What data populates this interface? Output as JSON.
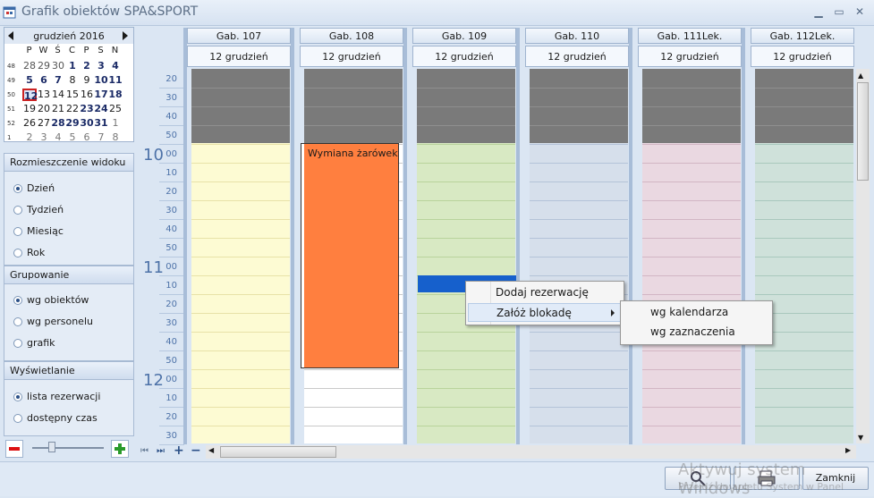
{
  "window": {
    "title": "Grafik obiektów SPA&SPORT",
    "min_label": "▁",
    "max_label": "▭",
    "close_label": "✕",
    "system_icon": "calendar-app-icon"
  },
  "calendar": {
    "month_label": "grudzień 2016",
    "weekdays": [
      "P",
      "W",
      "Ś",
      "C",
      "P",
      "S",
      "N"
    ],
    "weeks": [
      {
        "wk": "48",
        "days": [
          "28",
          "29",
          "30",
          "1",
          "2",
          "3",
          "4"
        ]
      },
      {
        "wk": "49",
        "days": [
          "5",
          "6",
          "7",
          "8",
          "9",
          "10",
          "11"
        ]
      },
      {
        "wk": "50",
        "days": [
          "12",
          "13",
          "14",
          "15",
          "16",
          "17",
          "18"
        ]
      },
      {
        "wk": "51",
        "days": [
          "19",
          "20",
          "21",
          "22",
          "23",
          "24",
          "25"
        ]
      },
      {
        "wk": "52",
        "days": [
          "26",
          "27",
          "28",
          "29",
          "30",
          "31",
          "1"
        ]
      },
      {
        "wk": "1",
        "days": [
          "2",
          "3",
          "4",
          "5",
          "6",
          "7",
          "8"
        ]
      }
    ]
  },
  "layout_panel": {
    "title": "Rozmieszczenie widoku",
    "options": [
      "Dzień",
      "Tydzień",
      "Miesiąc",
      "Rok"
    ],
    "selected": "Dzień"
  },
  "grouping_panel": {
    "title": "Grupowanie",
    "options": [
      "wg obiektów",
      "wg personelu",
      "grafik"
    ],
    "selected": "wg obiektów"
  },
  "display_panel": {
    "title": "Wyświetlanie",
    "options": [
      "lista rezerwacji",
      "dostępny czas"
    ],
    "selected": "lista rezerwacji"
  },
  "zoom": {
    "minus_label": "−",
    "plus_label": "+"
  },
  "timeline": {
    "rows": [
      {
        "min": "20"
      },
      {
        "min": "30"
      },
      {
        "min": "40"
      },
      {
        "min": "50"
      },
      {
        "hour": "10",
        "min": "00"
      },
      {
        "min": "10"
      },
      {
        "min": "20"
      },
      {
        "min": "30"
      },
      {
        "min": "40"
      },
      {
        "min": "50"
      },
      {
        "hour": "11",
        "min": "00"
      },
      {
        "min": "10"
      },
      {
        "min": "20"
      },
      {
        "min": "30"
      },
      {
        "min": "40"
      },
      {
        "min": "50"
      },
      {
        "hour": "12",
        "min": "00"
      },
      {
        "min": "10"
      },
      {
        "min": "20"
      },
      {
        "min": "30"
      }
    ]
  },
  "columns": [
    {
      "name": "Gab. 107",
      "date": "12 grudzień",
      "color": "#fdfbd3",
      "line": "#e8e2a8"
    },
    {
      "name": "Gab. 108",
      "date": "12 grudzień",
      "color": "#ffffff",
      "line": "#c9c9c9"
    },
    {
      "name": "Gab. 109",
      "date": "12 grudzień",
      "color": "#d8e9c3",
      "line": "#b9d39c"
    },
    {
      "name": "Gab. 110",
      "date": "12 grudzień",
      "color": "#d6dfeb",
      "line": "#b4c3d8"
    },
    {
      "name": "Gab. 111Lek.",
      "date": "12 grudzień",
      "color": "#ead8e1",
      "line": "#d2b6c4"
    },
    {
      "name": "Gab. 112Lek.",
      "date": "12 grudzień",
      "color": "#cfe1da",
      "line": "#a9c8bd"
    }
  ],
  "event": {
    "title": "Wymiana żarówek",
    "color": "#ff7f3f"
  },
  "context_menu": {
    "items": [
      "Dodaj rezerwację",
      "Załóż blokadę"
    ]
  },
  "submenu": {
    "items": [
      "wg kalendarza",
      "wg zaznaczenia"
    ]
  },
  "nav": {
    "first": "⏮",
    "last": "⏭",
    "add": "+",
    "remove": "−"
  },
  "buttons": {
    "close": "Zamknij"
  },
  "watermark": {
    "line1": "Aktywuj system Windows",
    "line2": "Przejdź do apletu System w Panel"
  }
}
